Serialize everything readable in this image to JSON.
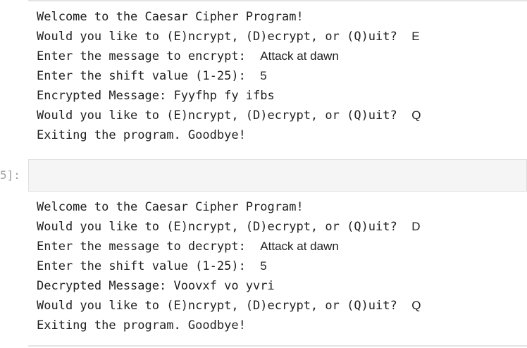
{
  "cell_prompt": "5]:",
  "outputs": [
    {
      "welcome": "Welcome to the Caesar Cipher Program!",
      "prompt1": "Would you like to (E)ncrypt, (D)ecrypt, or (Q)uit?  ",
      "answer1": "E",
      "msg_prompt": "Enter the message to encrypt:  ",
      "msg_value": "Attack at dawn",
      "shift_prompt": "Enter the shift value (1-25):  ",
      "shift_value": "5",
      "result": "Encrypted Message: Fyyfhp fy ifbs",
      "prompt2": "Would you like to (E)ncrypt, (D)ecrypt, or (Q)uit?  ",
      "answer2": "Q",
      "exit": "Exiting the program. Goodbye!"
    },
    {
      "welcome": "Welcome to the Caesar Cipher Program!",
      "prompt1": "Would you like to (E)ncrypt, (D)ecrypt, or (Q)uit?  ",
      "answer1": "D",
      "msg_prompt": "Enter the message to decrypt:  ",
      "msg_value": "Attack at dawn",
      "shift_prompt": "Enter the shift value (1-25):  ",
      "shift_value": "5",
      "result": "Decrypted Message: Voovxf vo yvri",
      "prompt2": "Would you like to (E)ncrypt, (D)ecrypt, or (Q)uit?  ",
      "answer2": "Q",
      "exit": "Exiting the program. Goodbye!"
    }
  ]
}
